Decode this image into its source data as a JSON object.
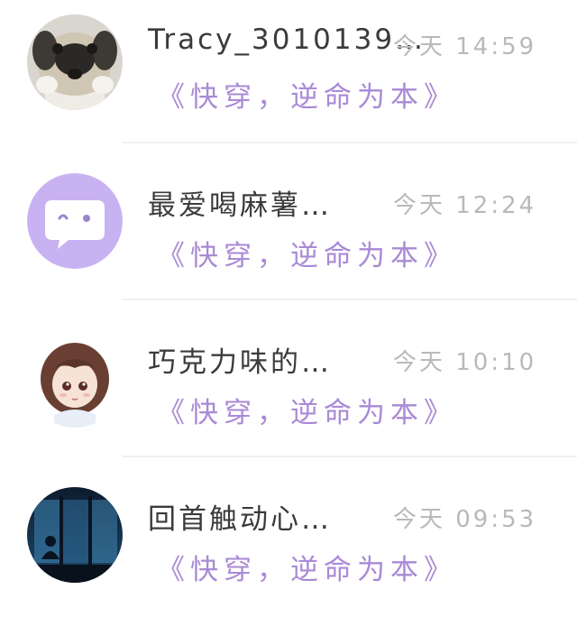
{
  "conversations": [
    {
      "name": "Tracy_3010139…",
      "time": "今天 14:59",
      "message": "《快穿，逆命为本》",
      "avatar_icon": "pug-dog-avatar"
    },
    {
      "name": "最爱喝麻薯…",
      "time": "今天 12:24",
      "message": "《快穿，逆命为本》",
      "avatar_icon": "chat-bubble-face-avatar"
    },
    {
      "name": "巧克力味的…",
      "time": "今天 10:10",
      "message": "《快穿，逆命为本》",
      "avatar_icon": "anime-girl-avatar"
    },
    {
      "name": "回首触动心…",
      "time": "今天 09:53",
      "message": "《快穿，逆命为本》",
      "avatar_icon": "night-window-avatar"
    }
  ],
  "colors": {
    "accent_purple": "#a98ad6",
    "name_text": "#3b3b3b",
    "time_text": "#b9b9b9",
    "avatar_purple_bg": "#c9b2f2"
  }
}
